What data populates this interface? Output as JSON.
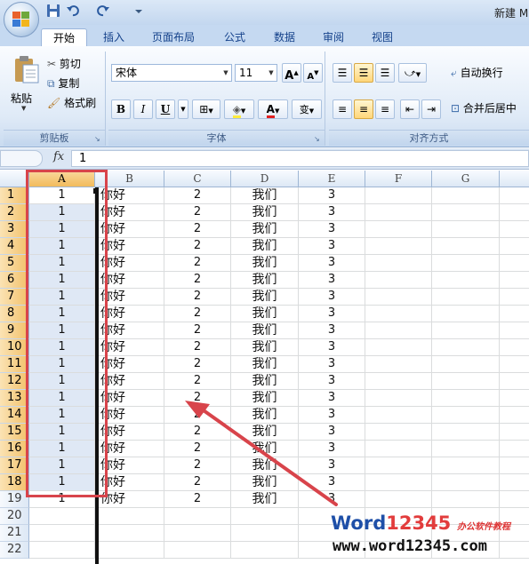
{
  "window": {
    "title": "新建 M"
  },
  "tabs": [
    "开始",
    "插入",
    "页面布局",
    "公式",
    "数据",
    "审阅",
    "视图"
  ],
  "clipboard": {
    "paste": "粘贴",
    "cut": "剪切",
    "copy": "复制",
    "format_painter": "格式刷",
    "label": "剪贴板"
  },
  "font": {
    "name": "宋体",
    "size": "11",
    "bold": "B",
    "italic": "I",
    "underline": "U",
    "grow": "A",
    "shrink": "A",
    "font_color": "A",
    "phonetic": "变",
    "label": "字体"
  },
  "alignment": {
    "wrap": "自动换行",
    "merge": "合并后居中",
    "label": "对齐方式"
  },
  "formula_bar": {
    "fx": "fx",
    "value": "1"
  },
  "grid": {
    "columns": [
      "A",
      "B",
      "C",
      "D",
      "E",
      "F",
      "G"
    ],
    "rows": [
      "1",
      "2",
      "3",
      "4",
      "5",
      "6",
      "7",
      "8",
      "9",
      "10",
      "11",
      "12",
      "13",
      "14",
      "15",
      "16",
      "17",
      "18",
      "19",
      "20",
      "21",
      "22"
    ],
    "col_a": [
      "1",
      "1",
      "1",
      "1",
      "1",
      "1",
      "1",
      "1",
      "1",
      "1",
      "1",
      "1",
      "1",
      "1",
      "1",
      "1",
      "1",
      "1",
      "1"
    ],
    "col_b": [
      "你好",
      "你好",
      "你好",
      "你好",
      "你好",
      "你好",
      "你好",
      "你好",
      "你好",
      "你好",
      "你好",
      "你好",
      "你好",
      "你好",
      "你好",
      "你好",
      "你好",
      "你好",
      "你好"
    ],
    "col_c": [
      "2",
      "2",
      "2",
      "2",
      "2",
      "2",
      "2",
      "2",
      "2",
      "2",
      "2",
      "2",
      "2",
      "2",
      "2",
      "2",
      "2",
      "2",
      "2"
    ],
    "col_d": [
      "我们",
      "我们",
      "我们",
      "我们",
      "我们",
      "我们",
      "我们",
      "我们",
      "我们",
      "我们",
      "我们",
      "我们",
      "我们",
      "我们",
      "我们",
      "我们",
      "我们",
      "我们",
      "我们"
    ],
    "col_e": [
      "3",
      "3",
      "3",
      "3",
      "3",
      "3",
      "3",
      "3",
      "3",
      "3",
      "3",
      "3",
      "3",
      "3",
      "3",
      "3",
      "3",
      "3",
      "3"
    ]
  },
  "watermark": {
    "brand_word": "Word",
    "brand_num": "12345",
    "cn": "办公软件教程",
    "url": "www.word12345.com"
  },
  "colors": {
    "annotation": "#d8444b",
    "selection": "#dfe8f5"
  }
}
